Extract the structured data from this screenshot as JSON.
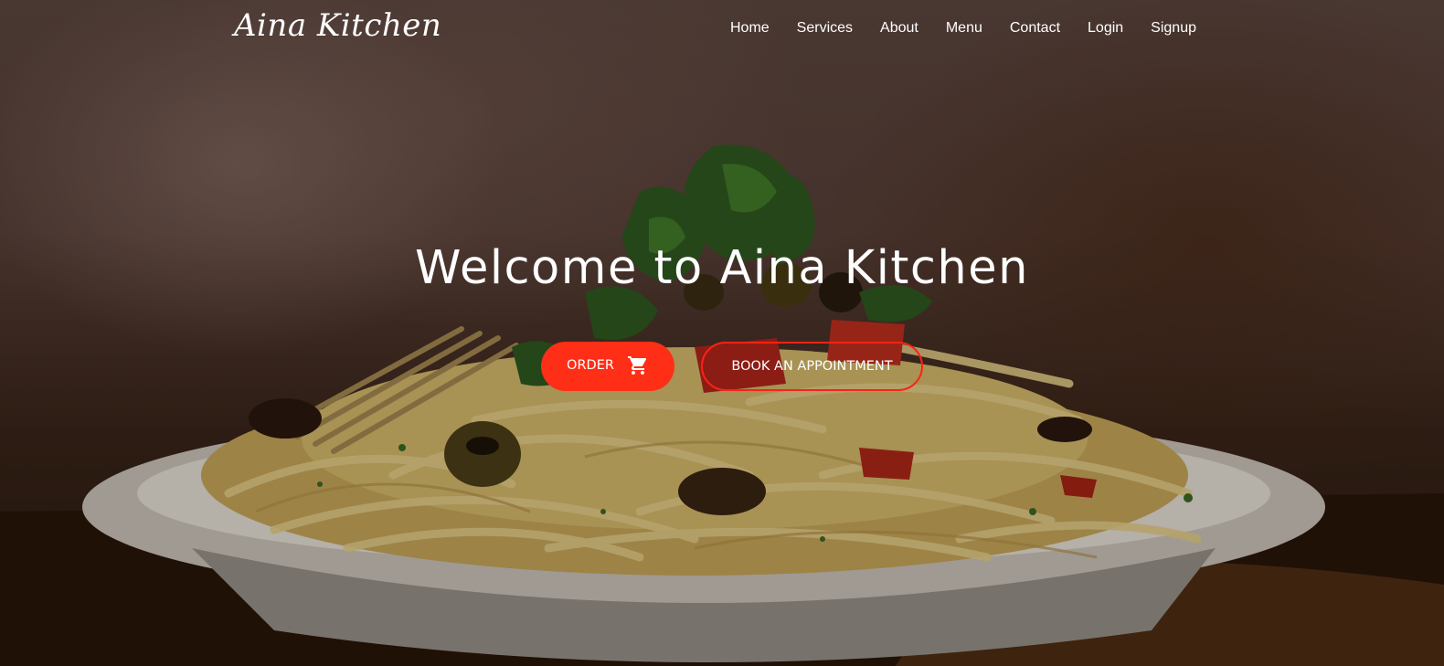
{
  "brand": {
    "name": "Aina Kitchen"
  },
  "nav": {
    "items": [
      {
        "label": "Home"
      },
      {
        "label": "Services"
      },
      {
        "label": "About"
      },
      {
        "label": "Menu"
      },
      {
        "label": "Contact"
      },
      {
        "label": "Login"
      },
      {
        "label": "Signup"
      }
    ]
  },
  "hero": {
    "title": "Welcome to Aina Kitchen",
    "order_button": {
      "label": "ORDER",
      "icon": "cart-icon"
    },
    "book_button": {
      "label": "BOOK AN APPOINTMENT"
    }
  },
  "colors": {
    "accent": "#ff2e17",
    "text": "#ffffff"
  }
}
